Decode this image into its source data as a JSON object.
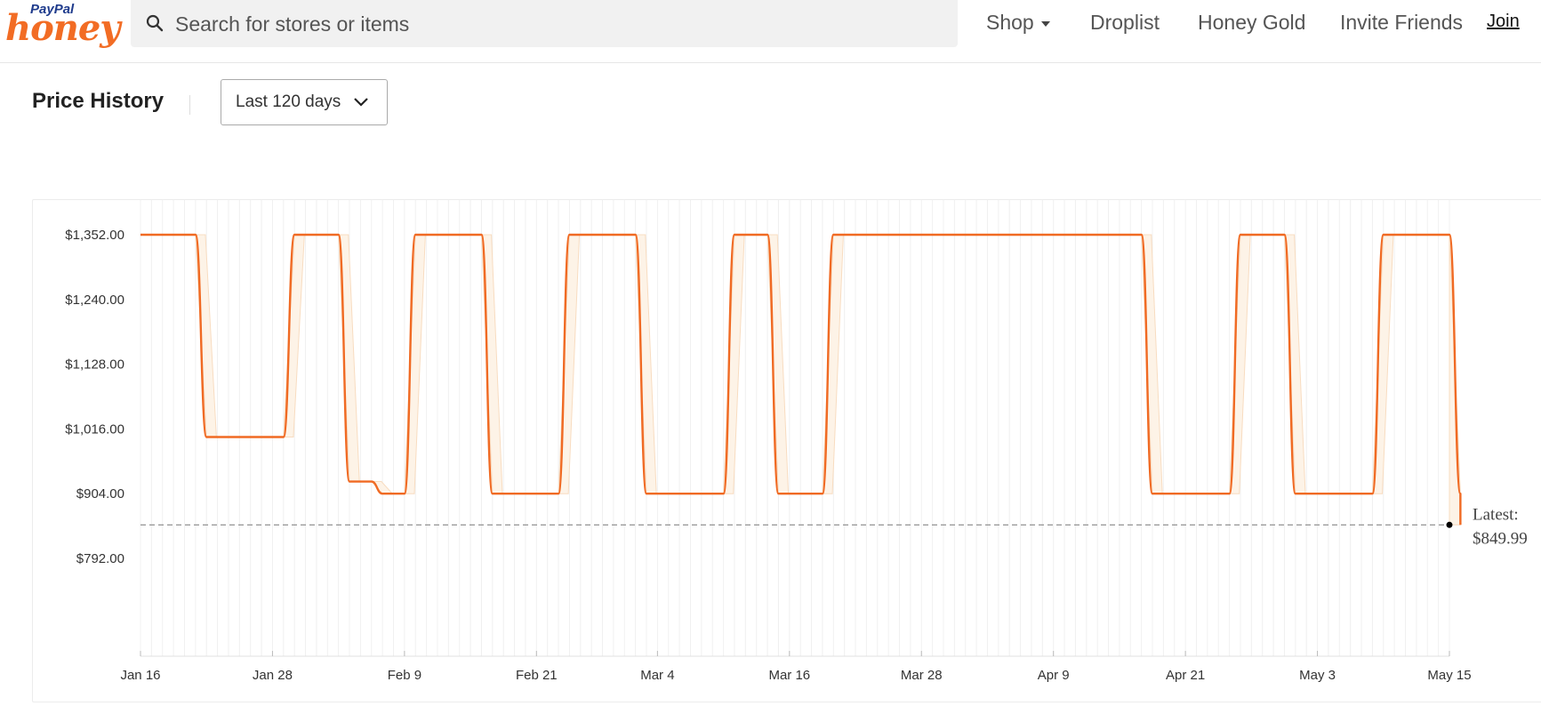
{
  "header": {
    "logo_top": "PayPal",
    "logo_main": "honey",
    "search": {
      "placeholder": "Search for stores or items"
    },
    "nav": {
      "shop": "Shop",
      "droplist": "Droplist",
      "honey_gold": "Honey Gold",
      "invite": "Invite Friends",
      "join": "Join"
    }
  },
  "price_history": {
    "title": "Price History",
    "range_selected": "Last 120 days"
  },
  "colors": {
    "line": "#f06a23",
    "band": "#fdf3e7",
    "band_edge": "#f8dcc0",
    "accent": "#f26c24"
  },
  "chart_data": {
    "type": "line",
    "title": "",
    "xlabel": "",
    "ylabel": "",
    "x_ticks": [
      "Jan 16",
      "Jan 28",
      "Feb 9",
      "Feb 21",
      "Mar 4",
      "Mar 16",
      "Mar 28",
      "Apr 9",
      "Apr 21",
      "May 3",
      "May 15"
    ],
    "y_ticks": [
      "$1,352.00",
      "$1,240.00",
      "$1,128.00",
      "$1,016.00",
      "$904.00",
      "$792.00"
    ],
    "xlim": [
      "Jan 16",
      "May 15"
    ],
    "ylim": [
      768,
      1400
    ],
    "grid": "vertical daily",
    "x": [
      "Jan 16",
      "Jan 21",
      "Jan 22",
      "Jan 29",
      "Jan 30",
      "Feb 3",
      "Feb 4",
      "Feb 6",
      "Feb 7",
      "Feb 9",
      "Feb 10",
      "Feb 16",
      "Feb 17",
      "Feb 23",
      "Feb 24",
      "Mar 2",
      "Mar 3",
      "Mar 10",
      "Mar 11",
      "Mar 14",
      "Mar 15",
      "Mar 19",
      "Mar 20",
      "Mar 28",
      "Mar 29",
      "Apr 17",
      "Apr 18",
      "Apr 25",
      "Apr 26",
      "Apr 30",
      "May 1",
      "May 8",
      "May 9",
      "May 15",
      "May 16",
      "May 16"
    ],
    "series": [
      {
        "values": [
          1352,
          1352,
          1002,
          1002,
          1352,
          1352,
          925,
          925,
          904,
          904,
          1352,
          1352,
          904,
          904,
          1352,
          1352,
          904,
          904,
          1352,
          1352,
          904,
          904,
          1352,
          1352,
          1352,
          1352,
          904,
          904,
          1352,
          1352,
          904,
          904,
          1352,
          1352,
          904,
          849.99
        ]
      }
    ],
    "latest": {
      "label": "Latest:",
      "value": "$849.99",
      "value_num": 849.99
    }
  }
}
